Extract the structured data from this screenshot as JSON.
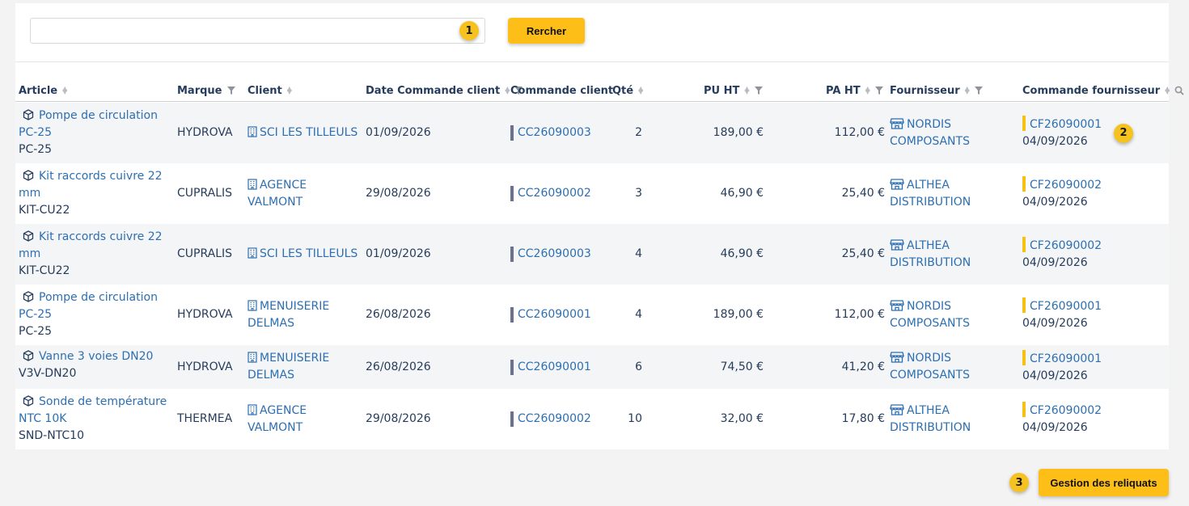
{
  "search": {
    "value": "",
    "placeholder": "",
    "badge": "1"
  },
  "search_button": "Rercher",
  "columns": {
    "article": "Article",
    "marque": "Marque",
    "client": "Client",
    "date": "Date Commande client",
    "cmd_client": "Commande client",
    "qte": "Qté",
    "pu": "PU HT",
    "pa": "PA HT",
    "fournisseur": "Fournisseur",
    "cmd_fournisseur": "Commande fournisseur"
  },
  "rows": [
    {
      "article_name": "Pompe de circulation PC-25",
      "article_ref": "PC-25",
      "marque": "HYDROVA",
      "client": "SCI LES TILLEULS",
      "date": "01/09/2026",
      "cmd_client": "CC26090003",
      "qte": "2",
      "pu": "189,00 €",
      "pa": "112,00 €",
      "fournisseur": "NORDIS COMPOSANTS",
      "cmd_fournisseur": "CF26090001",
      "cmd_fournisseur_date": "04/09/2026",
      "badge": "2"
    },
    {
      "article_name": "Kit raccords cuivre 22 mm",
      "article_ref": "KIT-CU22",
      "marque": "CUPRALIS",
      "client": "AGENCE VALMONT",
      "date": "29/08/2026",
      "cmd_client": "CC26090002",
      "qte": "3",
      "pu": "46,90 €",
      "pa": "25,40 €",
      "fournisseur": "ALTHEA DISTRIBUTION",
      "cmd_fournisseur": "CF26090002",
      "cmd_fournisseur_date": "04/09/2026"
    },
    {
      "article_name": "Kit raccords cuivre 22 mm",
      "article_ref": "KIT-CU22",
      "marque": "CUPRALIS",
      "client": "SCI LES TILLEULS",
      "date": "01/09/2026",
      "cmd_client": "CC26090003",
      "qte": "4",
      "pu": "46,90 €",
      "pa": "25,40 €",
      "fournisseur": "ALTHEA DISTRIBUTION",
      "cmd_fournisseur": "CF26090002",
      "cmd_fournisseur_date": "04/09/2026"
    },
    {
      "article_name": "Pompe de circulation PC-25",
      "article_ref": "PC-25",
      "marque": "HYDROVA",
      "client": "MENUISERIE DELMAS",
      "date": "26/08/2026",
      "cmd_client": "CC26090001",
      "qte": "4",
      "pu": "189,00 €",
      "pa": "112,00 €",
      "fournisseur": "NORDIS COMPOSANTS",
      "cmd_fournisseur": "CF26090001",
      "cmd_fournisseur_date": "04/09/2026"
    },
    {
      "article_name": "Vanne 3 voies DN20",
      "article_ref": "V3V-DN20",
      "marque": "HYDROVA",
      "client": "MENUISERIE DELMAS",
      "date": "26/08/2026",
      "cmd_client": "CC26090001",
      "qte": "6",
      "pu": "74,50 €",
      "pa": "41,20 €",
      "fournisseur": "NORDIS COMPOSANTS",
      "cmd_fournisseur": "CF26090001",
      "cmd_fournisseur_date": "04/09/2026"
    },
    {
      "article_name": "Sonde de température NTC 10K",
      "article_ref": "SND-NTC10",
      "marque": "THERMEA",
      "client": "AGENCE VALMONT",
      "date": "29/08/2026",
      "cmd_client": "CC26090002",
      "qte": "10",
      "pu": "32,00 €",
      "pa": "17,80 €",
      "fournisseur": "ALTHEA DISTRIBUTION",
      "cmd_fournisseur": "CF26090002",
      "cmd_fournisseur_date": "04/09/2026"
    }
  ],
  "footer": {
    "button": "Gestion des reliquats",
    "badge": "3"
  },
  "colors": {
    "accent": "#fdbe17",
    "link": "#2c6fb2",
    "badge": "#f6c220",
    "client_order_bar": "#6b7190",
    "supplier_order_bar": "#f5c214"
  }
}
